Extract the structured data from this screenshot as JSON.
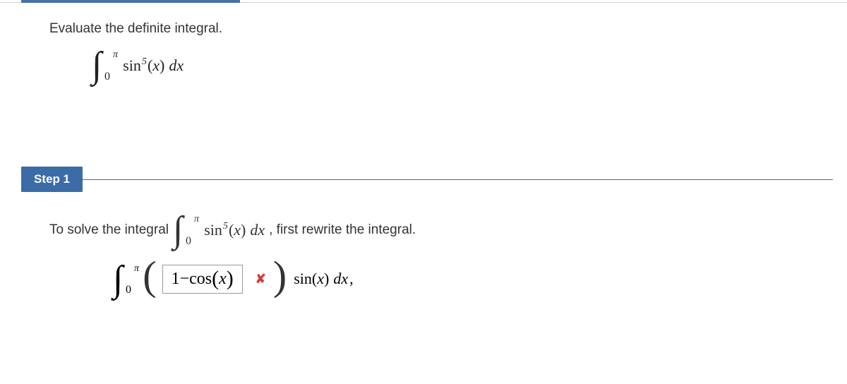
{
  "top": {
    "prompt": "Evaluate the definite integral."
  },
  "math": {
    "int_upper": "π",
    "int_lower": "0",
    "sin": "sin",
    "power": "5",
    "arg": "x",
    "dx": "dx"
  },
  "step": {
    "label": "Step 1"
  },
  "solution": {
    "lead": "To solve the integral",
    "trail": ", first rewrite the integral."
  },
  "rewrite": {
    "one": "1",
    "minus": " − ",
    "cos": "cos",
    "arg": "x",
    "answer_text": "1 − cos(x)",
    "sin": "sin",
    "sinarg": "x",
    "dx": "dx",
    "comma": ","
  }
}
